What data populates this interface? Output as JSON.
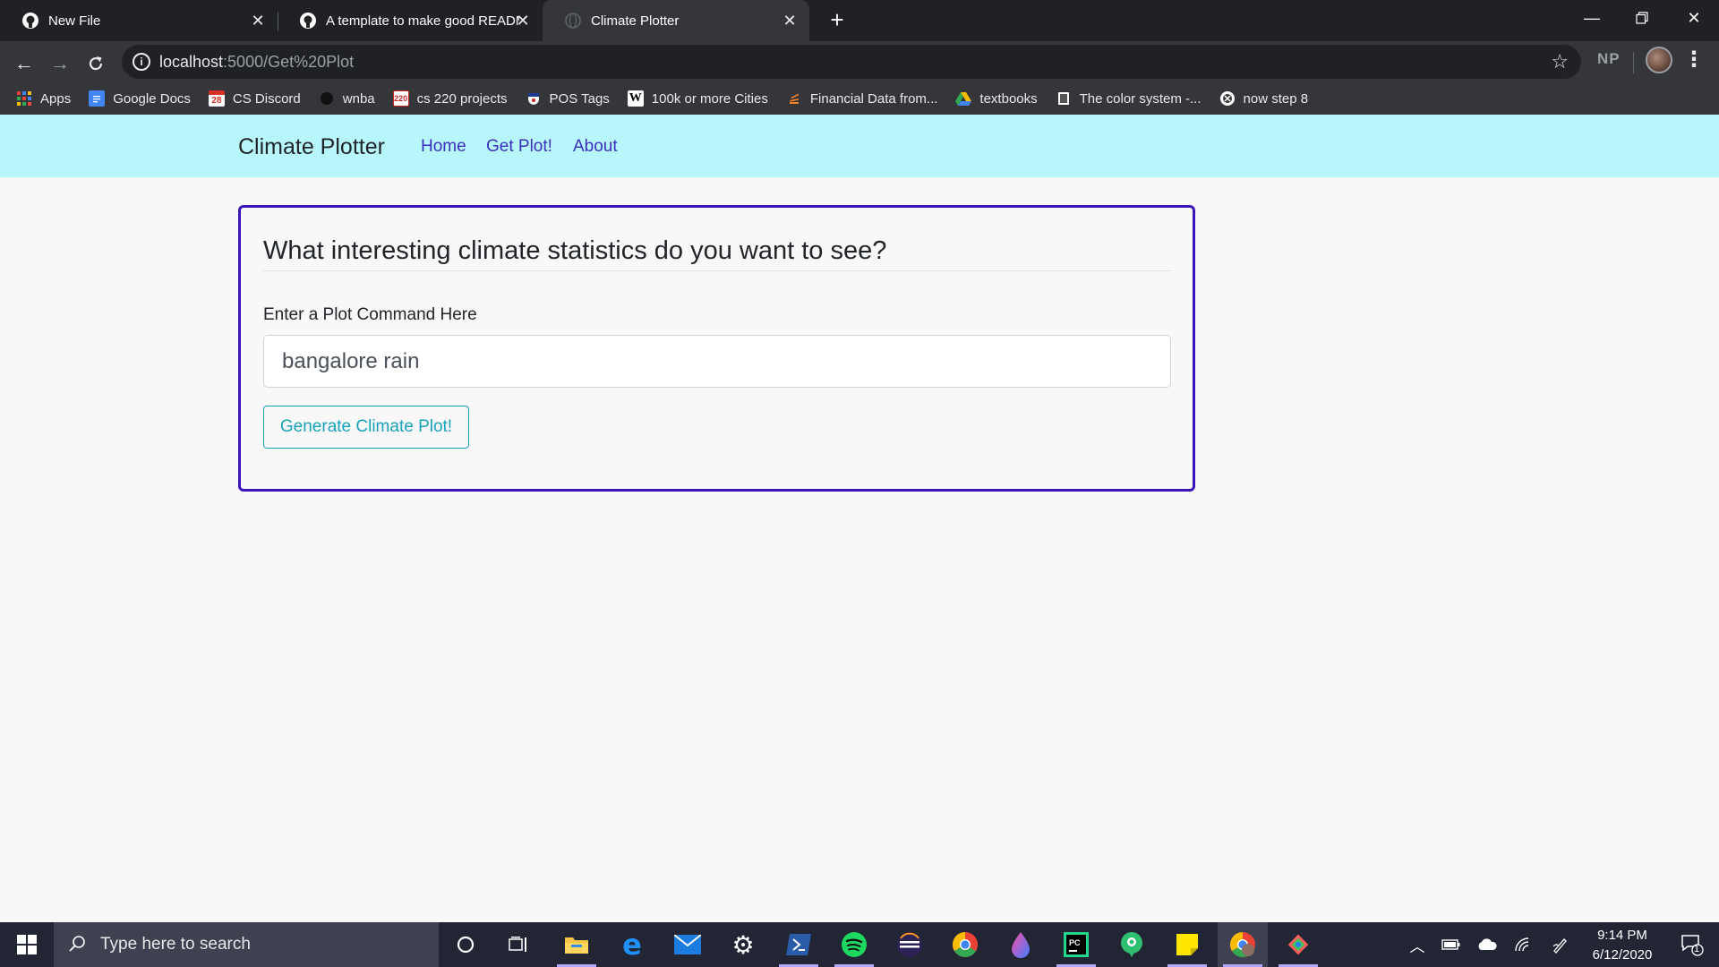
{
  "browser": {
    "tabs": [
      {
        "title": "New File"
      },
      {
        "title": "A template to make good READM"
      },
      {
        "title": "Climate Plotter"
      }
    ],
    "address": {
      "host": "localhost",
      "path": ":5000/Get%20Plot"
    },
    "profile_initials": "NP",
    "bookmarks": [
      {
        "label": "Apps",
        "icon": "apps-grid-icon"
      },
      {
        "label": "Google Docs",
        "icon": "google-docs-icon"
      },
      {
        "label": "CS Discord",
        "icon": "calendar-icon",
        "icon_text": "28"
      },
      {
        "label": "wnba",
        "icon": "basketball-icon"
      },
      {
        "label": "cs 220 projects",
        "icon": "course-icon",
        "icon_text": "220"
      },
      {
        "label": "POS Tags",
        "icon": "upenn-icon"
      },
      {
        "label": "100k or more Cities",
        "icon": "wikipedia-icon",
        "icon_text": "W"
      },
      {
        "label": "Financial Data from...",
        "icon": "stack-icon"
      },
      {
        "label": "textbooks",
        "icon": "google-drive-icon"
      },
      {
        "label": "The color system -...",
        "icon": "bootstrap-icon"
      },
      {
        "label": "now step 8",
        "icon": "globe-icon"
      }
    ]
  },
  "site": {
    "brand": "Climate Plotter",
    "nav": [
      "Home",
      "Get Plot!",
      "About"
    ]
  },
  "form": {
    "heading": "What interesting climate statistics do you want to see?",
    "label": "Enter a Plot Command Here",
    "input_value": "bangalore rain",
    "button": "Generate Climate Plot!"
  },
  "taskbar": {
    "search_placeholder": "Type here to search",
    "time": "9:14 PM",
    "date": "6/12/2020",
    "notifications": "1"
  },
  "colors": {
    "navbar_bg": "#b7f7fb",
    "card_border": "#3b14b8",
    "nav_link": "#3b2fbe",
    "button_accent": "#17a2b8"
  }
}
